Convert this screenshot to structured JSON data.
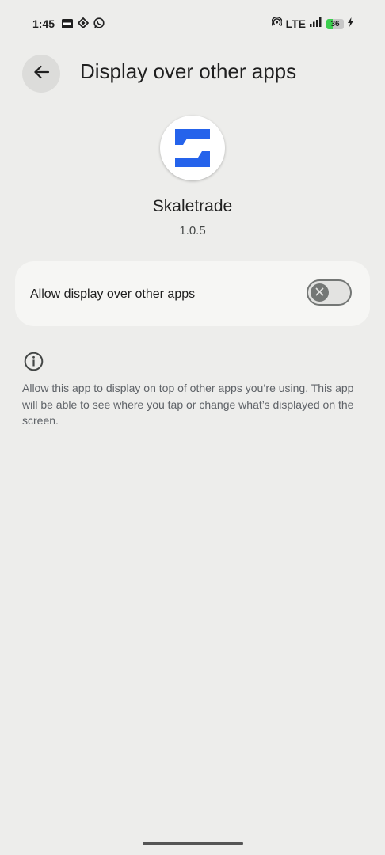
{
  "status_bar": {
    "time": "1:45",
    "network": "LTE",
    "battery": "36",
    "battery_level": 0.36,
    "icons": [
      "notification-icon",
      "vpn-icon",
      "whatsapp-icon",
      "hotspot-icon",
      "signal-icon",
      "charging-icon"
    ]
  },
  "header": {
    "title": "Display over other apps",
    "back_icon": "arrow-back-icon"
  },
  "app": {
    "name": "Skaletrade",
    "version": "1.0.5",
    "brand_color": "#2563eb"
  },
  "setting": {
    "label": "Allow display over other apps",
    "enabled": false
  },
  "info": {
    "icon": "info-icon",
    "text": "Allow this app to display on top of other apps you’re using. This app will be able to see where you tap or change what’s displayed on the screen."
  }
}
